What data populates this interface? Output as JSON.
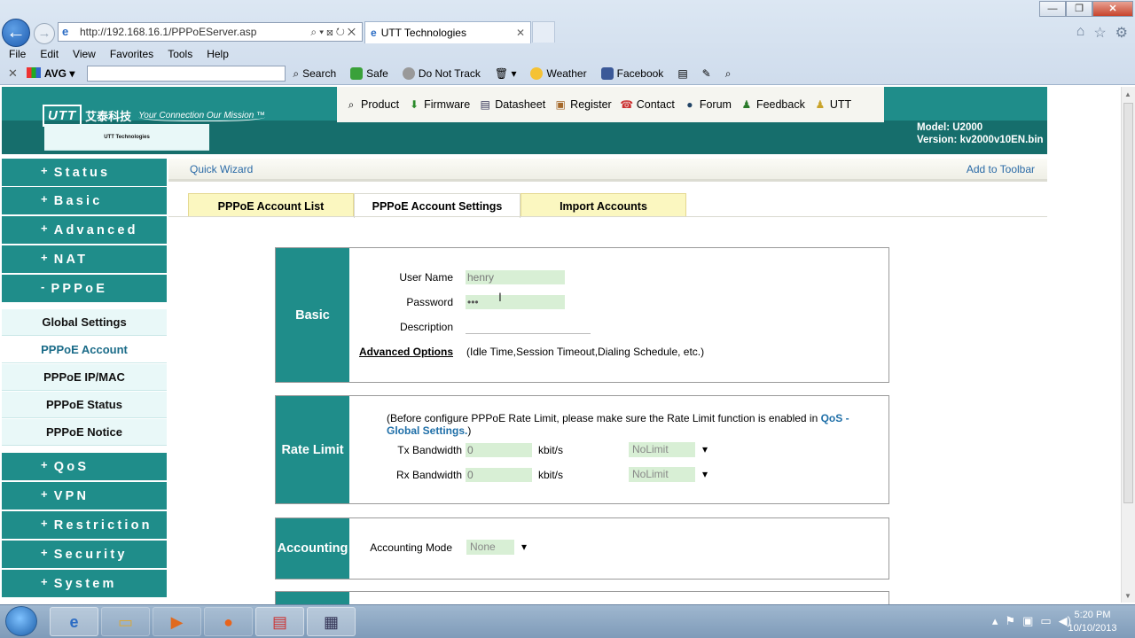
{
  "browser": {
    "url": "http://192.168.16.1/PPPoEServer.asp",
    "tab_title": "UTT Technologies",
    "menu": [
      "File",
      "Edit",
      "View",
      "Favorites",
      "Tools",
      "Help"
    ],
    "toolbar": {
      "avg_label": "AVG",
      "search_label": "Search",
      "safe_label": "Safe",
      "donottrack_label": "Do Not Track",
      "weather_label": "Weather",
      "facebook_label": "Facebook"
    }
  },
  "header": {
    "logo_box": "UTT",
    "logo_cn": "艾泰科技",
    "logo_sub": "UTT Technologies",
    "slogan": "Your Connection  Our Mission ™",
    "model": "Model: U2000",
    "version": "Version: kv2000v10EN.bin",
    "nav": [
      "Product",
      "Firmware",
      "Datasheet",
      "Register",
      "Contact",
      "Forum",
      "Feedback",
      "UTT"
    ]
  },
  "sidebar": {
    "items": [
      {
        "sign": "+",
        "label": "Status"
      },
      {
        "sign": "+",
        "label": "Basic"
      },
      {
        "sign": "+",
        "label": "Advanced"
      },
      {
        "sign": "+",
        "label": "NAT"
      },
      {
        "sign": "-",
        "label": "PPPoE"
      }
    ],
    "sub_items": [
      "Global Settings",
      "PPPoE Account",
      "PPPoE IP/MAC",
      "PPPoE Status",
      "PPPoE Notice"
    ],
    "items_after": [
      {
        "sign": "+",
        "label": "QoS"
      },
      {
        "sign": "+",
        "label": "VPN"
      },
      {
        "sign": "+",
        "label": "Restriction"
      },
      {
        "sign": "+",
        "label": "Security"
      },
      {
        "sign": "+",
        "label": "System"
      }
    ]
  },
  "quickbar": {
    "left": "Quick Wizard",
    "right": "Add to Toolbar"
  },
  "tabs": [
    "PPPoE Account List",
    "PPPoE Account Settings",
    "Import Accounts"
  ],
  "basic": {
    "title": "Basic",
    "username_label": "User Name",
    "username_value": "henry",
    "password_label": "Password",
    "password_value": "•••",
    "description_label": "Description",
    "advanced_link": "Advanced Options",
    "advanced_hint": "(Idle Time,Session Timeout,Dialing Schedule, etc.)"
  },
  "rate": {
    "title": "Rate Limit",
    "note_prefix": "(Before configure PPPoE Rate Limit, please make sure the Rate Limit function is enabled in ",
    "note_link": "QoS - Global Settings.",
    "note_suffix": ")",
    "tx_label": "Tx Bandwidth",
    "tx_value": "0",
    "rx_label": "Rx Bandwidth",
    "rx_value": "0",
    "unit": "kbit/s",
    "tx_select": "NoLimit",
    "rx_select": "NoLimit"
  },
  "accounting": {
    "title": "Accounting",
    "mode_label": "Accounting Mode",
    "mode_value": "None"
  },
  "taskbar": {
    "time": "5:20 PM",
    "date": "10/10/2013"
  }
}
